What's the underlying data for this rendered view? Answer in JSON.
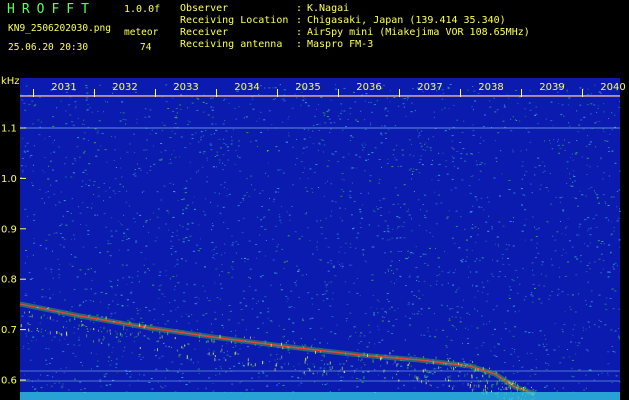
{
  "header": {
    "app_title": "HROFFT",
    "version": "1.0.0f",
    "filename": "KN9_2506202030.png",
    "meteor_label": "meteor",
    "datetime": "25.06.20 20:30",
    "meteor_count": "74"
  },
  "station": {
    "observer_label": "Observer",
    "observer_value": "K.Nagai",
    "location_label": "Receiving Location",
    "location_value": "Chigasaki, Japan (139.414 35.340)",
    "receiver_label": "Receiver",
    "receiver_value": "AirSpy mini (Miakejima VOR 108.65MHz)",
    "antenna_label": "Receiving antenna",
    "antenna_value": "Maspro FM-3",
    "separator": ":"
  },
  "axis": {
    "unit_label": "kHz",
    "y_ticks": [
      {
        "value": 1.1,
        "label": "1.1"
      },
      {
        "value": 1.0,
        "label": "1.0"
      },
      {
        "value": 0.9,
        "label": "0.9"
      },
      {
        "value": 0.8,
        "label": "0.8"
      },
      {
        "value": 0.7,
        "label": "0.7"
      },
      {
        "value": 0.6,
        "label": "0.6"
      }
    ],
    "time_ticks": [
      "2031",
      "2032",
      "2033",
      "2034",
      "2035",
      "2036",
      "2037",
      "2038",
      "2039",
      "2040"
    ]
  },
  "colors": {
    "background": "#0b1bb0",
    "text": "#ffff55",
    "title": "#59ff59",
    "noise_cyan": "#33c8d8",
    "noise_green": "#3cc83c",
    "signal_red": "#ff4030",
    "carrier": "#9ee8ff"
  }
}
